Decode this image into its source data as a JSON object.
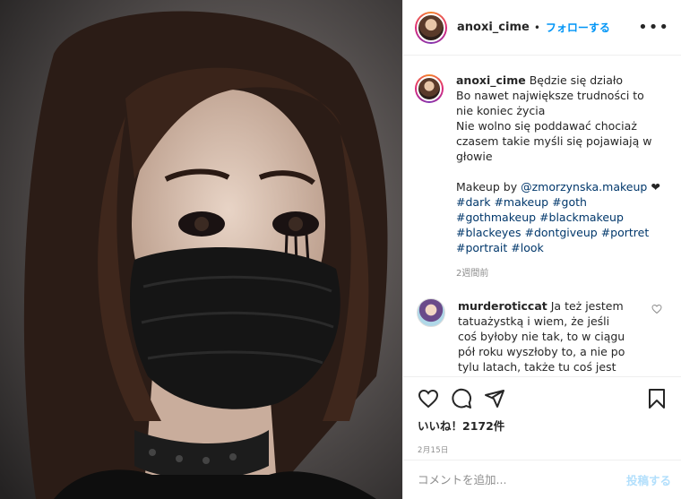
{
  "header": {
    "username": "anoxi_cime",
    "separator": "•",
    "follow_label": "フォローする",
    "more_label": "•••"
  },
  "caption": {
    "username": "anoxi_cime",
    "lines": [
      "Będzie się działo",
      "Bo nawet największe trudności to nie koniec życia",
      "Nie wolno się poddawać chociaż czasem takie myśli się pojawiają w głowie"
    ],
    "makeup_prefix": "Makeup by ",
    "makeup_handle": "@zmorzynska.makeup",
    "heart": "❤",
    "hashtags": [
      "#dark",
      "#makeup",
      "#goth",
      "#gothmakeup",
      "#blackmakeup",
      "#blackeyes",
      "#dontgiveup",
      "#portret",
      "#portrait",
      "#look"
    ],
    "time": "2週間前"
  },
  "comment": {
    "username": "murderoticcat",
    "text": "Ja też jestem tatuażystką i wiem, że jeśli coś byłoby nie tak, to w ciągu pół roku wyszłoby to, a nie po tylu latach, także tu coś jest przekombinowane"
  },
  "likes": "いいね！2172件",
  "date": "2月15日",
  "add_comment": {
    "placeholder": "コメントを追加...",
    "post_label": "投稿する"
  },
  "colors": {
    "link": "#00376b",
    "follow": "#0095f6",
    "post_disabled": "#b2dffc",
    "meta": "#8e8e8e"
  },
  "icons": [
    "heart-icon",
    "comment-icon",
    "share-icon",
    "bookmark-icon"
  ]
}
